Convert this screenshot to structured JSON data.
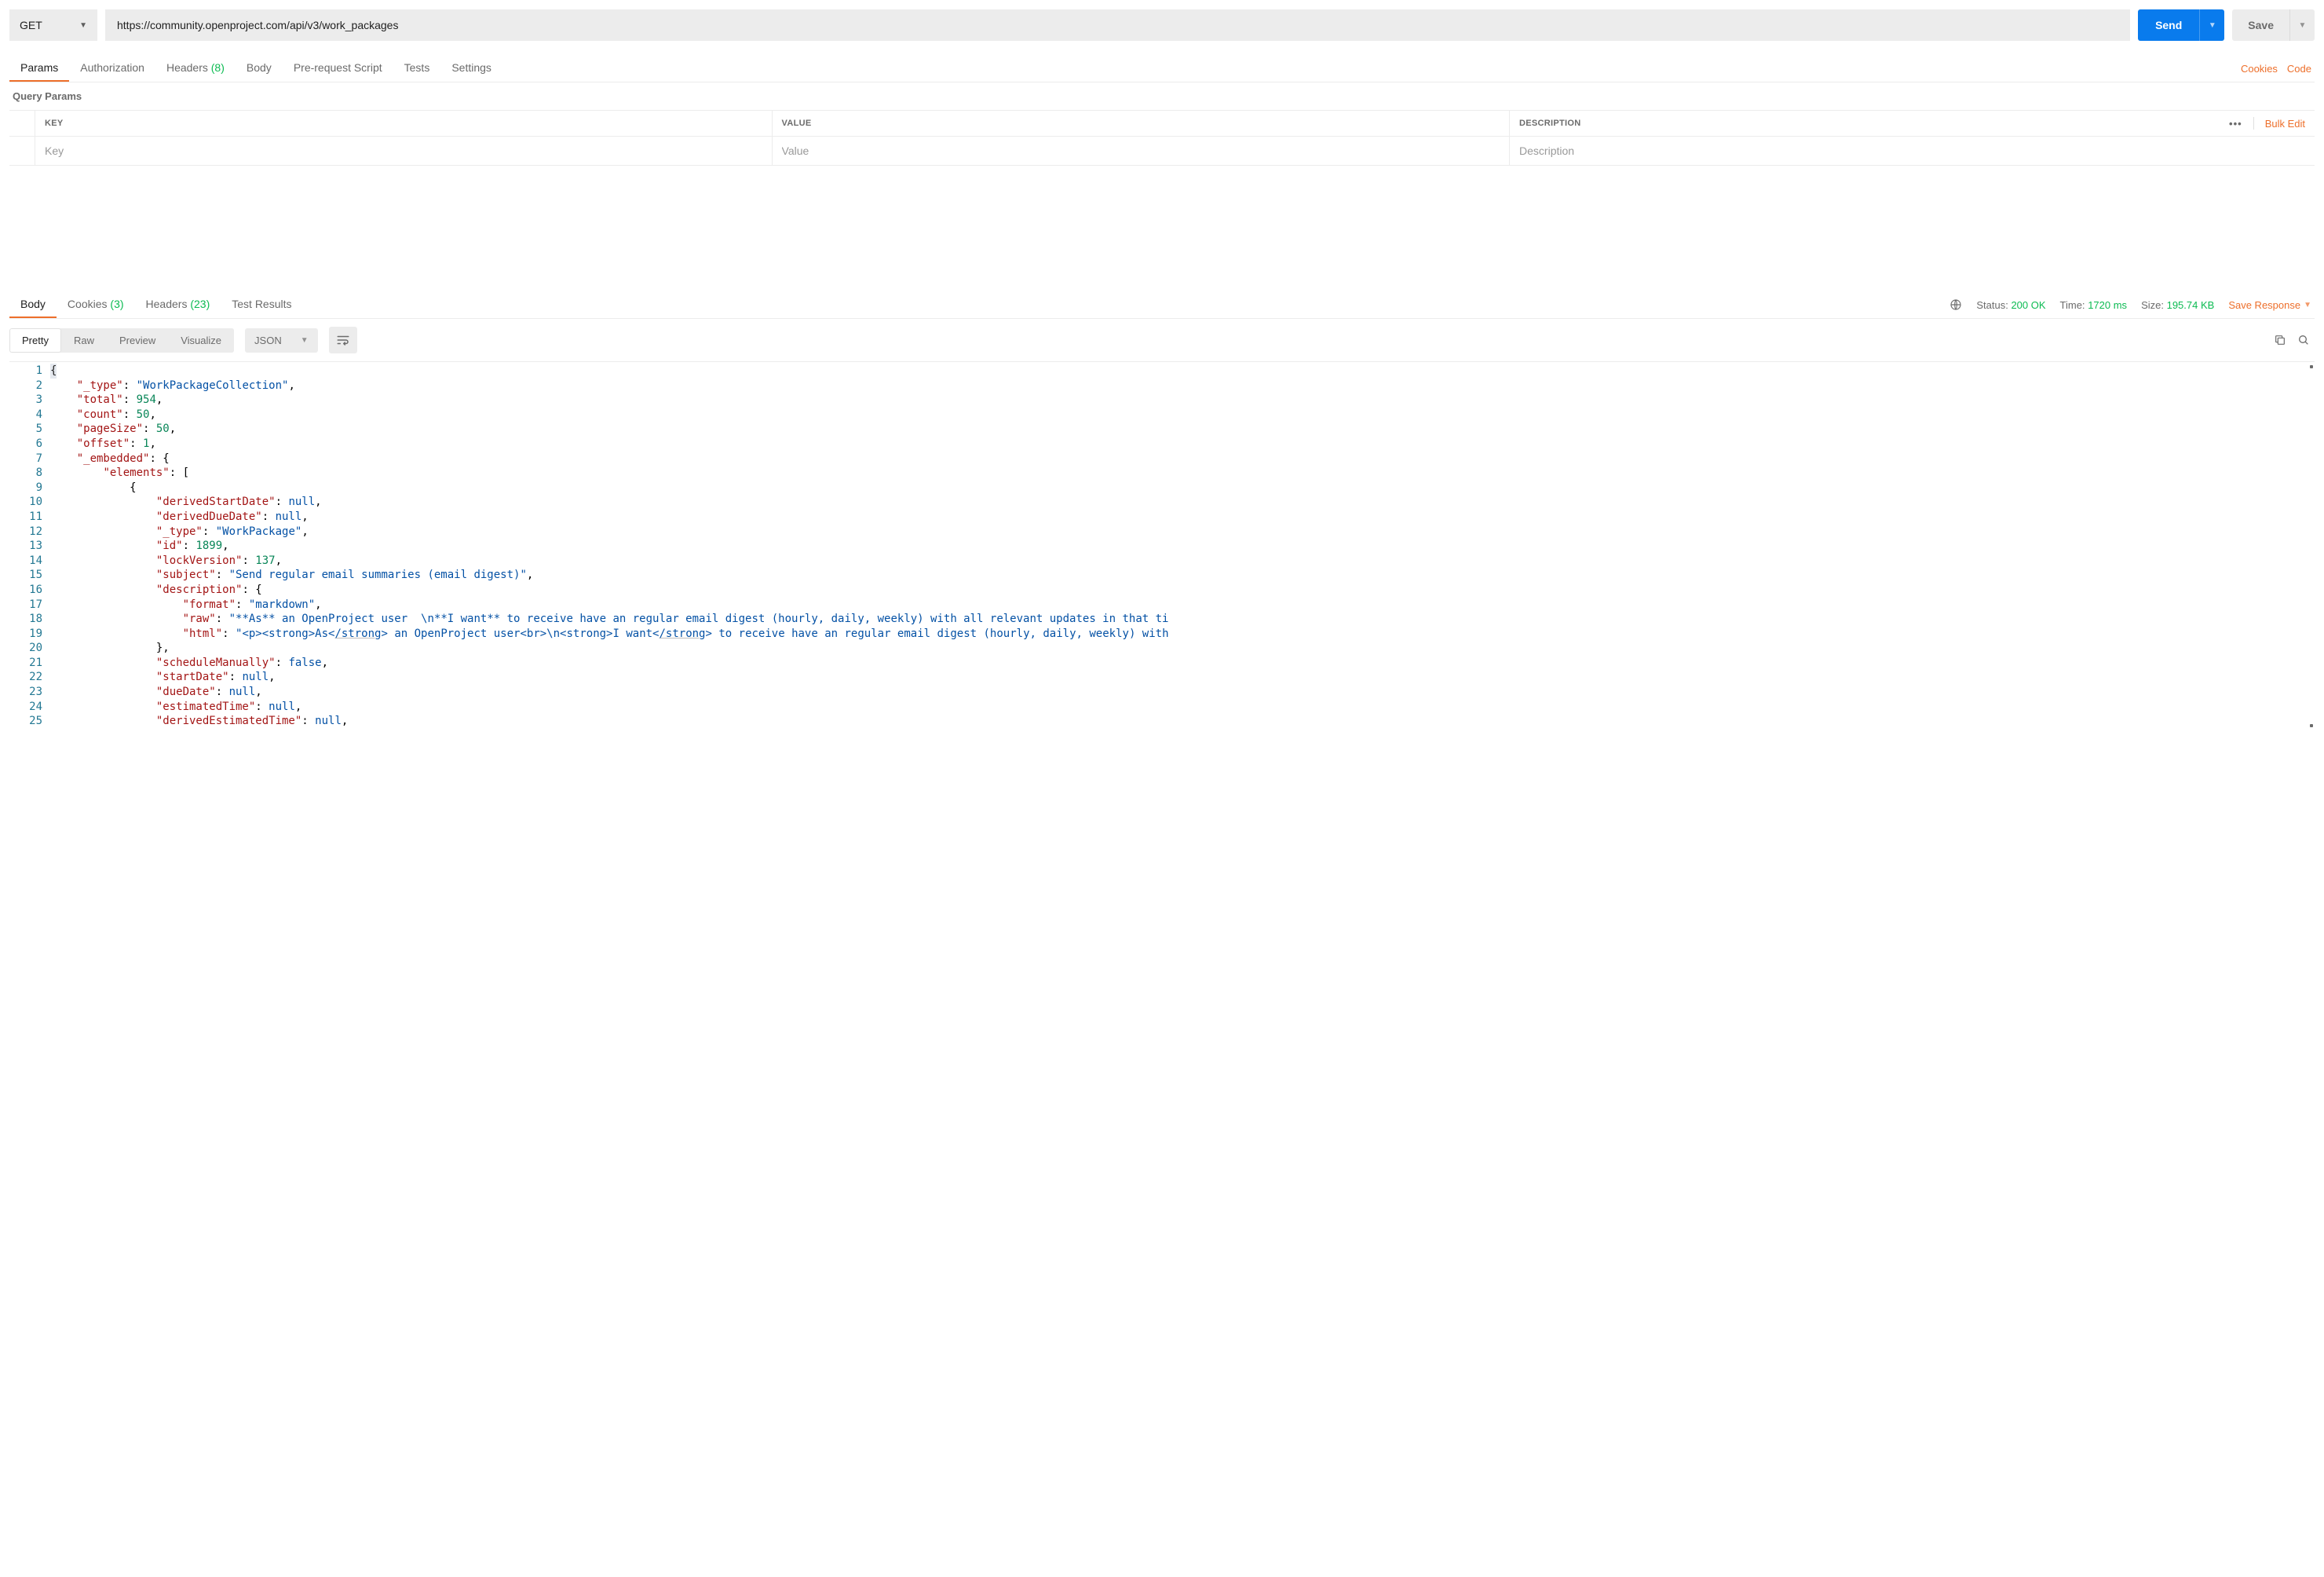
{
  "request": {
    "method": "GET",
    "url": "https://community.openproject.com/api/v3/work_packages",
    "send_label": "Send",
    "save_label": "Save"
  },
  "req_tabs": {
    "params": "Params",
    "authorization": "Authorization",
    "headers": "Headers",
    "headers_count": "(8)",
    "body": "Body",
    "prerequest": "Pre-request Script",
    "tests": "Tests",
    "settings": "Settings",
    "cookies_link": "Cookies",
    "code_link": "Code"
  },
  "query_params": {
    "title": "Query Params",
    "head_key": "KEY",
    "head_value": "VALUE",
    "head_desc": "DESCRIPTION",
    "bulk_edit": "Bulk Edit",
    "placeholder_key": "Key",
    "placeholder_value": "Value",
    "placeholder_desc": "Description"
  },
  "resp_tabs": {
    "body": "Body",
    "cookies": "Cookies",
    "cookies_count": "(3)",
    "headers": "Headers",
    "headers_count": "(23)",
    "test_results": "Test Results"
  },
  "resp_status": {
    "status_label": "Status:",
    "status_value": "200 OK",
    "time_label": "Time:",
    "time_value": "1720 ms",
    "size_label": "Size:",
    "size_value": "195.74 KB",
    "save_response": "Save Response"
  },
  "view": {
    "pretty": "Pretty",
    "raw": "Raw",
    "preview": "Preview",
    "visualize": "Visualize",
    "format": "JSON"
  },
  "code_lines": [
    [
      {
        "t": "hl",
        "v": "{"
      }
    ],
    [
      {
        "t": "ind",
        "v": 1
      },
      {
        "t": "key",
        "v": "\"_type\""
      },
      {
        "t": "punc",
        "v": ": "
      },
      {
        "t": "str",
        "v": "\"WorkPackageCollection\""
      },
      {
        "t": "punc",
        "v": ","
      }
    ],
    [
      {
        "t": "ind",
        "v": 1
      },
      {
        "t": "key",
        "v": "\"total\""
      },
      {
        "t": "punc",
        "v": ": "
      },
      {
        "t": "num",
        "v": "954"
      },
      {
        "t": "punc",
        "v": ","
      }
    ],
    [
      {
        "t": "ind",
        "v": 1
      },
      {
        "t": "key",
        "v": "\"count\""
      },
      {
        "t": "punc",
        "v": ": "
      },
      {
        "t": "num",
        "v": "50"
      },
      {
        "t": "punc",
        "v": ","
      }
    ],
    [
      {
        "t": "ind",
        "v": 1
      },
      {
        "t": "key",
        "v": "\"pageSize\""
      },
      {
        "t": "punc",
        "v": ": "
      },
      {
        "t": "num",
        "v": "50"
      },
      {
        "t": "punc",
        "v": ","
      }
    ],
    [
      {
        "t": "ind",
        "v": 1
      },
      {
        "t": "key",
        "v": "\"offset\""
      },
      {
        "t": "punc",
        "v": ": "
      },
      {
        "t": "num",
        "v": "1"
      },
      {
        "t": "punc",
        "v": ","
      }
    ],
    [
      {
        "t": "ind",
        "v": 1
      },
      {
        "t": "key",
        "v": "\"_embedded\""
      },
      {
        "t": "punc",
        "v": ": {"
      }
    ],
    [
      {
        "t": "ind",
        "v": 2
      },
      {
        "t": "key",
        "v": "\"elements\""
      },
      {
        "t": "punc",
        "v": ": ["
      }
    ],
    [
      {
        "t": "ind",
        "v": 3
      },
      {
        "t": "punc",
        "v": "{"
      }
    ],
    [
      {
        "t": "ind",
        "v": 4
      },
      {
        "t": "key",
        "v": "\"derivedStartDate\""
      },
      {
        "t": "punc",
        "v": ": "
      },
      {
        "t": "null",
        "v": "null"
      },
      {
        "t": "punc",
        "v": ","
      }
    ],
    [
      {
        "t": "ind",
        "v": 4
      },
      {
        "t": "key",
        "v": "\"derivedDueDate\""
      },
      {
        "t": "punc",
        "v": ": "
      },
      {
        "t": "null",
        "v": "null"
      },
      {
        "t": "punc",
        "v": ","
      }
    ],
    [
      {
        "t": "ind",
        "v": 4
      },
      {
        "t": "key",
        "v": "\"_type\""
      },
      {
        "t": "punc",
        "v": ": "
      },
      {
        "t": "str",
        "v": "\"WorkPackage\""
      },
      {
        "t": "punc",
        "v": ","
      }
    ],
    [
      {
        "t": "ind",
        "v": 4
      },
      {
        "t": "key",
        "v": "\"id\""
      },
      {
        "t": "punc",
        "v": ": "
      },
      {
        "t": "num",
        "v": "1899"
      },
      {
        "t": "punc",
        "v": ","
      }
    ],
    [
      {
        "t": "ind",
        "v": 4
      },
      {
        "t": "key",
        "v": "\"lockVersion\""
      },
      {
        "t": "punc",
        "v": ": "
      },
      {
        "t": "num",
        "v": "137"
      },
      {
        "t": "punc",
        "v": ","
      }
    ],
    [
      {
        "t": "ind",
        "v": 4
      },
      {
        "t": "key",
        "v": "\"subject\""
      },
      {
        "t": "punc",
        "v": ": "
      },
      {
        "t": "str",
        "v": "\"Send regular email summaries (email digest)\""
      },
      {
        "t": "punc",
        "v": ","
      }
    ],
    [
      {
        "t": "ind",
        "v": 4
      },
      {
        "t": "key",
        "v": "\"description\""
      },
      {
        "t": "punc",
        "v": ": {"
      }
    ],
    [
      {
        "t": "ind",
        "v": 5
      },
      {
        "t": "key",
        "v": "\"format\""
      },
      {
        "t": "punc",
        "v": ": "
      },
      {
        "t": "str",
        "v": "\"markdown\""
      },
      {
        "t": "punc",
        "v": ","
      }
    ],
    [
      {
        "t": "ind",
        "v": 5
      },
      {
        "t": "key",
        "v": "\"raw\""
      },
      {
        "t": "punc",
        "v": ": "
      },
      {
        "t": "str",
        "v": "\"**As** an OpenProject user  \\n**I want** to receive have an regular email digest (hourly, daily, weekly) with all relevant updates in that ti"
      }
    ],
    [
      {
        "t": "ind",
        "v": 5
      },
      {
        "t": "key",
        "v": "\"html\""
      },
      {
        "t": "punc",
        "v": ": "
      },
      {
        "t": "strhtml",
        "v": [
          "\"<p><strong>As<",
          "/strong",
          "> an OpenProject user<br>\\n<strong>I want<",
          "/strong",
          "> to receive have an regular email digest (hourly, daily, weekly) with"
        ]
      }
    ],
    [
      {
        "t": "ind",
        "v": 4
      },
      {
        "t": "punc",
        "v": "},"
      }
    ],
    [
      {
        "t": "ind",
        "v": 4
      },
      {
        "t": "key",
        "v": "\"scheduleManually\""
      },
      {
        "t": "punc",
        "v": ": "
      },
      {
        "t": "bool",
        "v": "false"
      },
      {
        "t": "punc",
        "v": ","
      }
    ],
    [
      {
        "t": "ind",
        "v": 4
      },
      {
        "t": "key",
        "v": "\"startDate\""
      },
      {
        "t": "punc",
        "v": ": "
      },
      {
        "t": "null",
        "v": "null"
      },
      {
        "t": "punc",
        "v": ","
      }
    ],
    [
      {
        "t": "ind",
        "v": 4
      },
      {
        "t": "key",
        "v": "\"dueDate\""
      },
      {
        "t": "punc",
        "v": ": "
      },
      {
        "t": "null",
        "v": "null"
      },
      {
        "t": "punc",
        "v": ","
      }
    ],
    [
      {
        "t": "ind",
        "v": 4
      },
      {
        "t": "key",
        "v": "\"estimatedTime\""
      },
      {
        "t": "punc",
        "v": ": "
      },
      {
        "t": "null",
        "v": "null"
      },
      {
        "t": "punc",
        "v": ","
      }
    ],
    [
      {
        "t": "ind",
        "v": 4
      },
      {
        "t": "key",
        "v": "\"derivedEstimatedTime\""
      },
      {
        "t": "punc",
        "v": ": "
      },
      {
        "t": "null",
        "v": "null"
      },
      {
        "t": "punc",
        "v": ","
      }
    ]
  ]
}
